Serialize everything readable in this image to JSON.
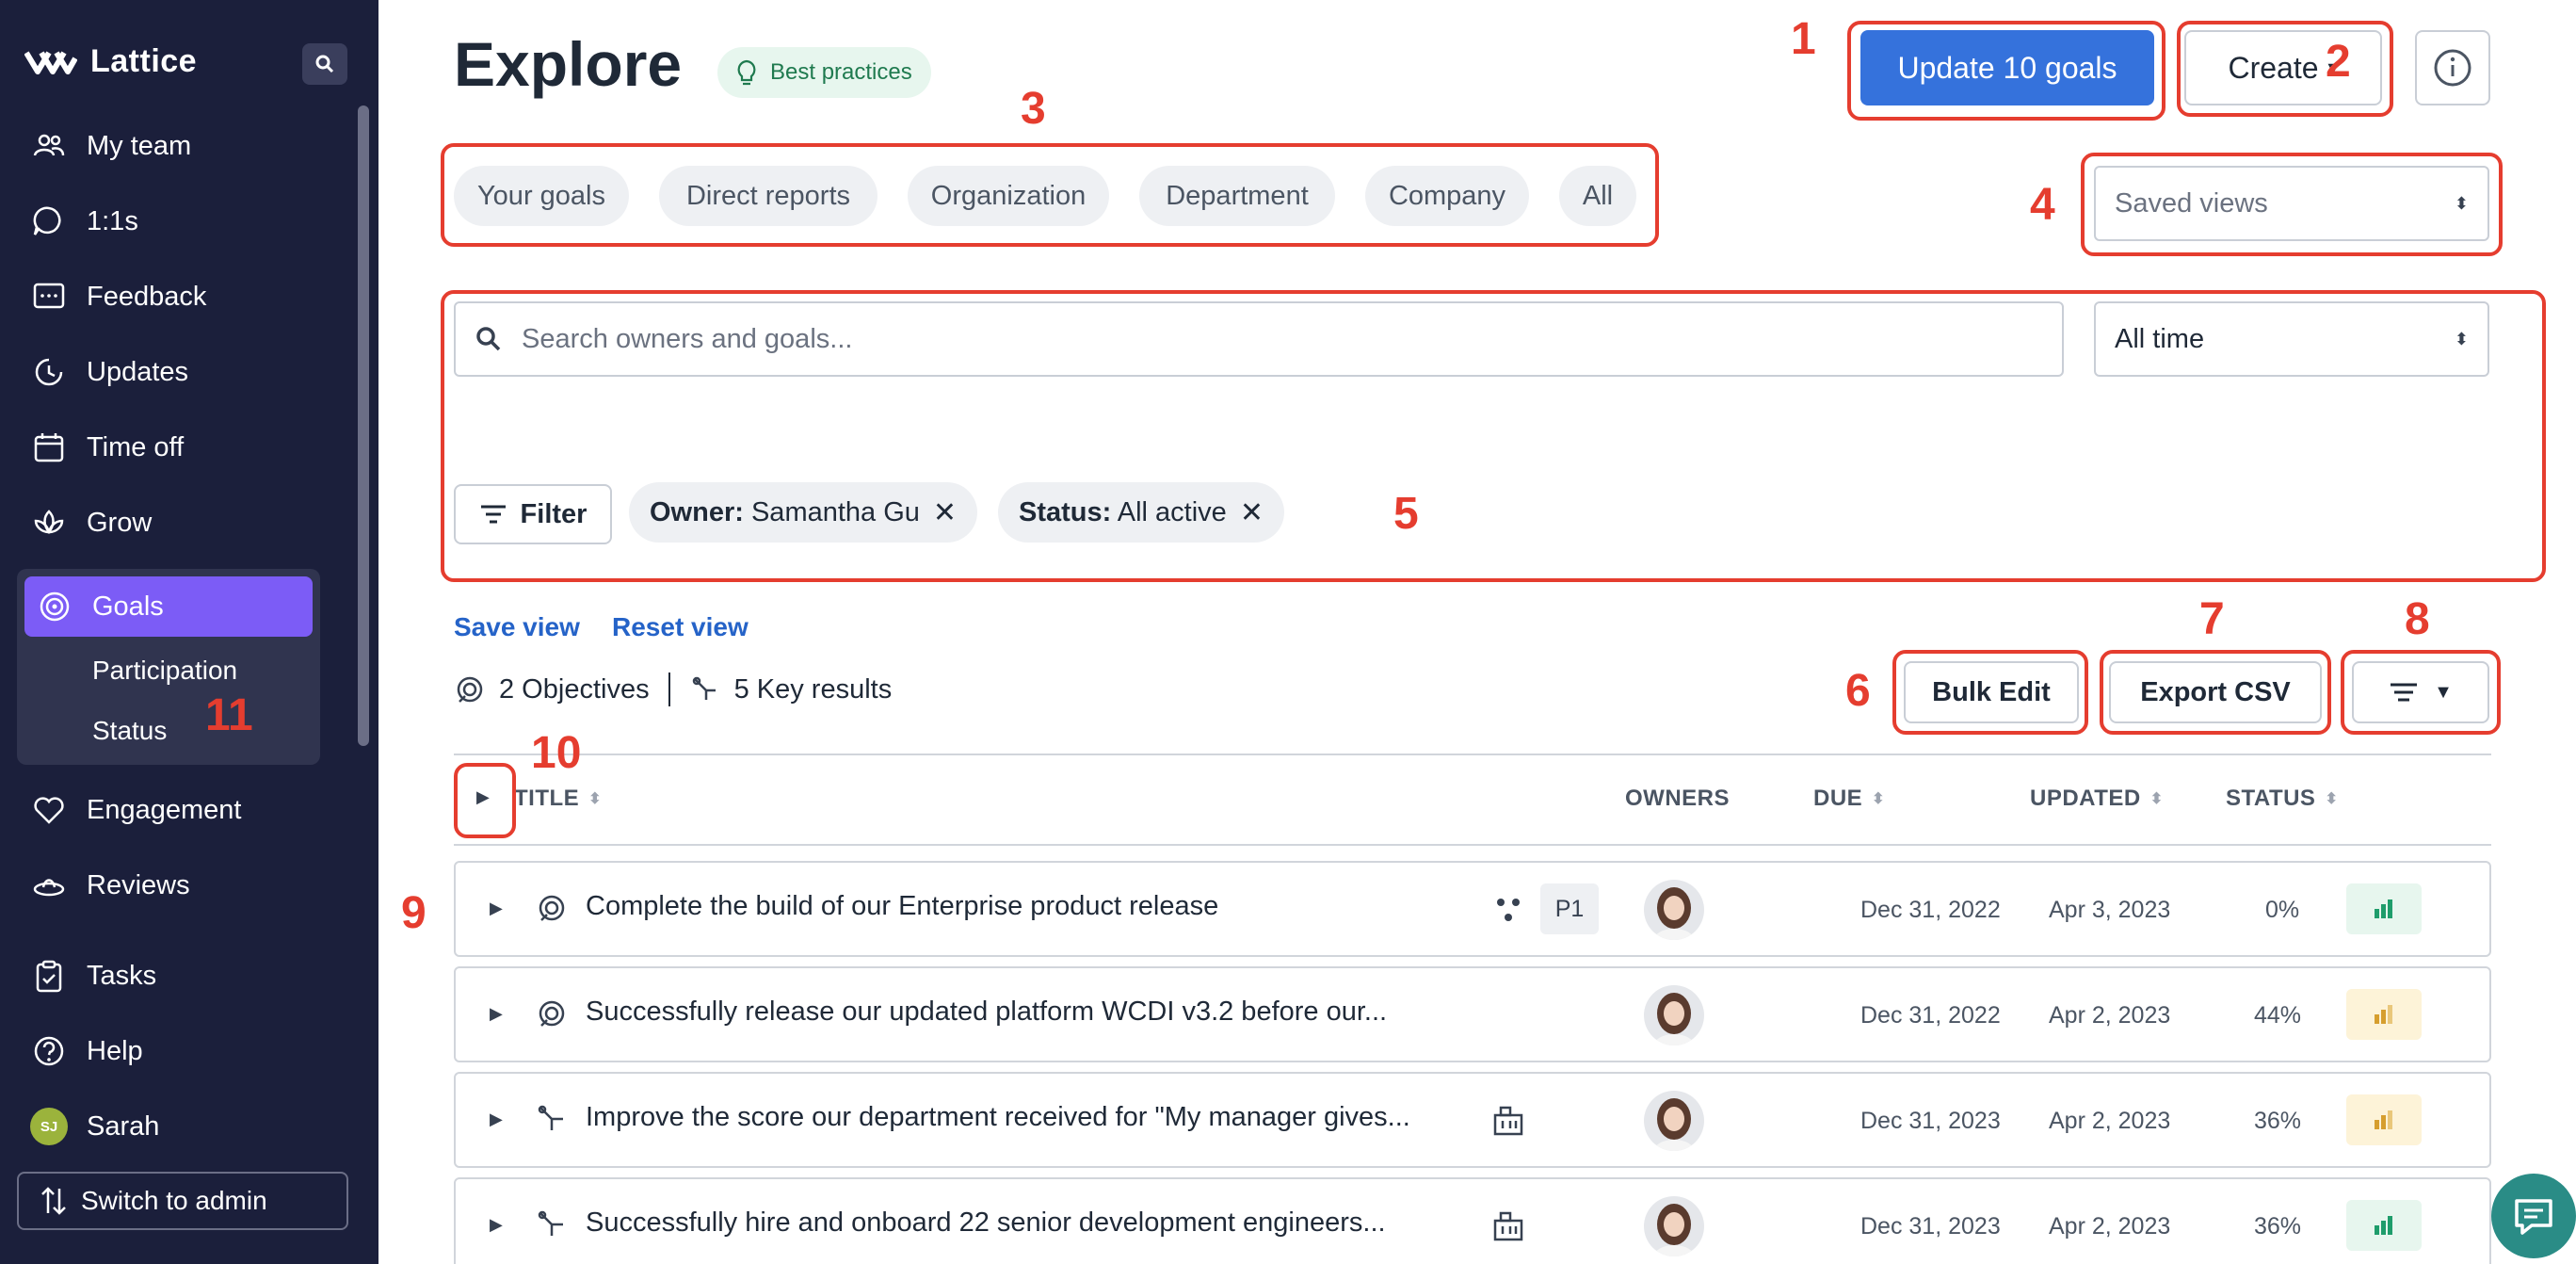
{
  "app": {
    "name": "Lattice"
  },
  "sidebar": {
    "items": [
      {
        "label": "My team",
        "icon": "team-icon"
      },
      {
        "label": "1:1s",
        "icon": "chat-icon"
      },
      {
        "label": "Feedback",
        "icon": "feedback-icon"
      },
      {
        "label": "Updates",
        "icon": "updates-icon"
      },
      {
        "label": "Time off",
        "icon": "calendar-icon"
      },
      {
        "label": "Grow",
        "icon": "lotus-icon"
      },
      {
        "label": "Goals",
        "icon": "target-icon",
        "active": true
      },
      {
        "label": "Engagement",
        "icon": "heart-icon"
      },
      {
        "label": "Reviews",
        "icon": "reviews-icon"
      },
      {
        "label": "Tasks",
        "icon": "clipboard-icon"
      },
      {
        "label": "Help",
        "icon": "help-icon"
      }
    ],
    "goals_sub": [
      "Participation",
      "Status"
    ],
    "user": {
      "name": "Sarah",
      "initials": "SJ"
    },
    "switch_label": "Switch to admin"
  },
  "header": {
    "title": "Explore",
    "best_practices": "Best practices",
    "update_button": "Update 10 goals",
    "create_button": "Create"
  },
  "scope_tabs": [
    "Your goals",
    "Direct reports",
    "Organization",
    "Department",
    "Company",
    "All"
  ],
  "saved_views": {
    "placeholder": "Saved views"
  },
  "search": {
    "placeholder": "Search owners and goals..."
  },
  "time_filter": {
    "value": "All time"
  },
  "filter_button": "Filter",
  "chips": [
    {
      "key": "Owner:",
      "value": "Samantha Gu"
    },
    {
      "key": "Status:",
      "value": "All active"
    }
  ],
  "view_links": {
    "save": "Save view",
    "reset": "Reset view"
  },
  "counts": {
    "objectives": "2 Objectives",
    "key_results": "5 Key results"
  },
  "actions": {
    "bulk_edit": "Bulk Edit",
    "export_csv": "Export CSV"
  },
  "table": {
    "headers": {
      "title": "TITLE",
      "owners": "OWNERS",
      "due": "DUE",
      "updated": "UPDATED",
      "status": "STATUS"
    },
    "rows": [
      {
        "title": "Complete the build of our Enterprise product release",
        "type": "objective",
        "priority": "P1",
        "due": "Dec 31, 2022",
        "updated": "Apr 3, 2023",
        "status": "0%",
        "status_color": "#1f9d6b",
        "badge_bg": "#e7f6ee"
      },
      {
        "title": "Successfully release our updated platform WCDI v3.2 before our...",
        "type": "objective",
        "priority": "",
        "due": "Dec 31, 2022",
        "updated": "Apr 2, 2023",
        "status": "44%",
        "status_color": "#d69e2e",
        "badge_bg": "#fdf3d8"
      },
      {
        "title": "Improve the score our department received for \"My manager gives...",
        "type": "key-result",
        "priority": "",
        "due": "Dec 31, 2023",
        "updated": "Apr 2, 2023",
        "status": "36%",
        "status_color": "#d69e2e",
        "badge_bg": "#fdf3d8"
      },
      {
        "title": "Successfully hire and onboard 22 senior development engineers...",
        "type": "key-result",
        "priority": "",
        "due": "Dec 31, 2023",
        "updated": "Apr 2, 2023",
        "status": "36%",
        "status_color": "#1f9d6b",
        "badge_bg": "#e7f6ee"
      }
    ]
  },
  "annotations": [
    "1",
    "2",
    "3",
    "4",
    "5",
    "6",
    "7",
    "8",
    "9",
    "10",
    "11"
  ],
  "colors": {
    "sidebar": "#1b1f3b",
    "accent": "#7c5cf6",
    "primary": "#3572dc",
    "annotation": "#e53d2f"
  }
}
